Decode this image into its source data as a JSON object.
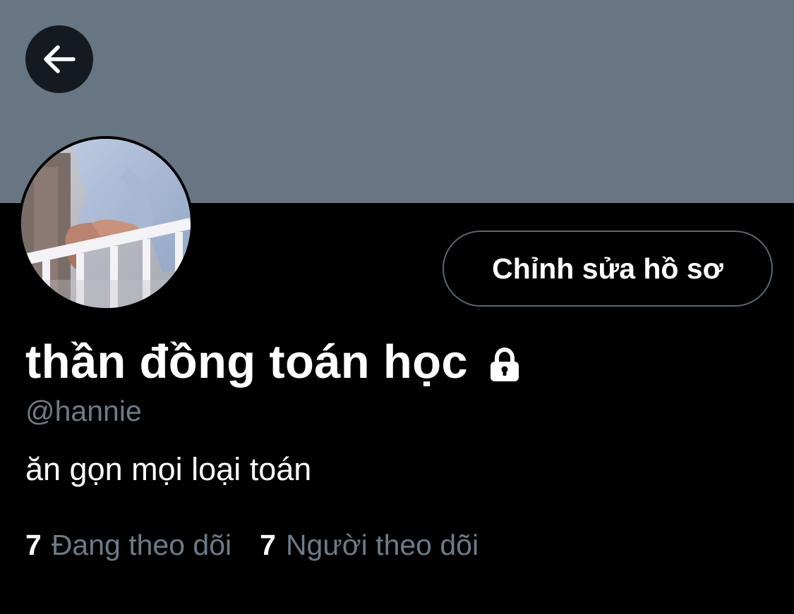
{
  "colors": {
    "banner": "#687684",
    "background": "#000000",
    "secondary_text": "#6e7b87",
    "primary_text": "#ffffff",
    "button_border": "#5a6670"
  },
  "header": {
    "back_icon": "arrow-left-icon"
  },
  "profile": {
    "display_name": "thần đồng toán học",
    "protected_icon": "lock-icon",
    "handle": "@hannie",
    "bio": "ăn gọn mọi loại toán",
    "edit_button_label": "Chỉnh sửa hồ sơ",
    "avatar_icon": "avatar-photo"
  },
  "stats": {
    "following_count": "7",
    "following_label": "Đang theo dõi",
    "followers_count": "7",
    "followers_label": "Người theo dõi"
  }
}
